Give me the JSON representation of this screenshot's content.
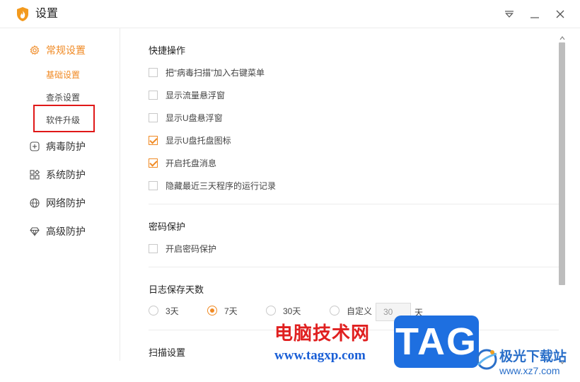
{
  "window": {
    "title": "设置",
    "icons": {
      "logo": "flame-shield-logo",
      "menu": "dropdown-menu-icon",
      "minimize": "minimize-icon",
      "close": "close-icon"
    }
  },
  "sidebar": {
    "items": [
      {
        "label": "常规设置",
        "icon": "gear-icon",
        "active": true
      },
      {
        "label": "病毒防护",
        "icon": "plus-circle-icon"
      },
      {
        "label": "系统防护",
        "icon": "grid-icon"
      },
      {
        "label": "网络防护",
        "icon": "globe-icon"
      },
      {
        "label": "高级防护",
        "icon": "diamond-icon"
      }
    ],
    "subitems": [
      {
        "label": "基础设置",
        "active": true
      },
      {
        "label": "查杀设置"
      },
      {
        "label": "软件升级",
        "highlighted": true
      }
    ]
  },
  "sections": {
    "quick_ops": {
      "title": "快捷操作",
      "options": [
        {
          "label": "把“病毒扫描”加入右键菜单",
          "checked": false
        },
        {
          "label": "显示流量悬浮窗",
          "checked": false
        },
        {
          "label": "显示U盘悬浮窗",
          "checked": false
        },
        {
          "label": "显示U盘托盘图标",
          "checked": true
        },
        {
          "label": "开启托盘消息",
          "checked": true
        },
        {
          "label": "隐藏最近三天程序的运行记录",
          "checked": false
        }
      ]
    },
    "password": {
      "title": "密码保护",
      "options": [
        {
          "label": "开启密码保护",
          "checked": false
        }
      ]
    },
    "log_days": {
      "title": "日志保存天数",
      "options": [
        {
          "label": "3天",
          "selected": false
        },
        {
          "label": "7天",
          "selected": true
        },
        {
          "label": "30天",
          "selected": false
        },
        {
          "label": "自定义",
          "selected": false
        }
      ],
      "custom_value": "30",
      "unit": "天"
    },
    "scan": {
      "title": "扫描设置"
    }
  },
  "watermark": {
    "site_name": "电脑技术网",
    "site_url": "www.tagxp.com",
    "tag": "TAG",
    "brand_cn": "极光下载站",
    "brand_url": "www.xz7.com"
  },
  "colors": {
    "accent": "#f08a24",
    "highlight_box": "#e01818",
    "tag_blue": "#1e6fe0"
  }
}
